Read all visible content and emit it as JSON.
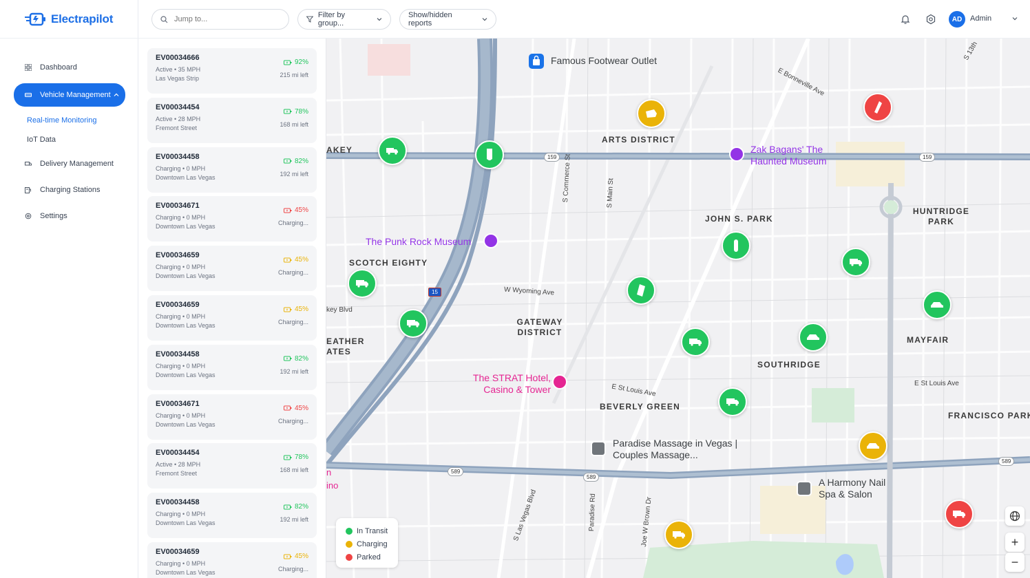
{
  "app": {
    "name": "Electrapilot",
    "brand_color": "#1d6fe6"
  },
  "sidebar": {
    "items": [
      {
        "label": "Dashboard",
        "icon": "grid-icon"
      },
      {
        "label": "Vehicle Management",
        "icon": "car-icon",
        "active": true
      },
      {
        "label": "Delivery Management",
        "icon": "truck-icon"
      },
      {
        "label": "Charging Stations",
        "icon": "charger-icon"
      },
      {
        "label": "Settings",
        "icon": "gear-icon"
      }
    ],
    "sub_items": [
      {
        "label": "Real-time Monitoring",
        "current": true
      },
      {
        "label": "IoT Data"
      }
    ]
  },
  "topbar": {
    "search_placeholder": "Jump to...",
    "filter_label": "Filter by group...",
    "reports_label": "Show/hidden reports",
    "user_initials": "AD",
    "user_name": "Admin"
  },
  "vehicles": [
    {
      "id": "EV00034666",
      "status": "Active • 35 MPH",
      "location": "Las Vegas Strip",
      "battery": "92%",
      "range": "215 mi left",
      "color": "#22c55e"
    },
    {
      "id": "EV00034454",
      "status": "Active • 28 MPH",
      "location": "Fremont Street",
      "battery": "78%",
      "range": "168 mi left",
      "color": "#22c55e"
    },
    {
      "id": "EV00034458",
      "status": "Charging • 0 MPH",
      "location": "Downtown Las Vegas",
      "battery": "82%",
      "range": "192 mi left",
      "color": "#22c55e"
    },
    {
      "id": "EV00034671",
      "status": "Charging • 0 MPH",
      "location": "Downtown Las Vegas",
      "battery": "45%",
      "range": "Charging...",
      "color": "#ef4444"
    },
    {
      "id": "EV00034659",
      "status": "Charging • 0 MPH",
      "location": "Downtown Las Vegas",
      "battery": "45%",
      "range": "Charging...",
      "color": "#eab308"
    },
    {
      "id": "EV00034659",
      "status": "Charging • 0 MPH",
      "location": "Downtown Las Vegas",
      "battery": "45%",
      "range": "Charging...",
      "color": "#eab308"
    },
    {
      "id": "EV00034458",
      "status": "Charging • 0 MPH",
      "location": "Downtown Las Vegas",
      "battery": "82%",
      "range": "192 mi left",
      "color": "#22c55e"
    },
    {
      "id": "EV00034671",
      "status": "Charging • 0 MPH",
      "location": "Downtown Las Vegas",
      "battery": "45%",
      "range": "Charging...",
      "color": "#ef4444"
    },
    {
      "id": "EV00034454",
      "status": "Active • 28 MPH",
      "location": "Fremont Street",
      "battery": "78%",
      "range": "168 mi left",
      "color": "#22c55e"
    },
    {
      "id": "EV00034458",
      "status": "Charging • 0 MPH",
      "location": "Downtown Las Vegas",
      "battery": "82%",
      "range": "192 mi left",
      "color": "#22c55e"
    },
    {
      "id": "EV00034659",
      "status": "Charging • 0 MPH",
      "location": "Downtown Las Vegas",
      "battery": "45%",
      "range": "Charging...",
      "color": "#eab308"
    }
  ],
  "map": {
    "districts": [
      "ARTS DISTRICT",
      "JOHN S. PARK",
      "HUNTRIDGE PARK",
      "SCOTCH EIGHTY",
      "GATEWAY DISTRICT",
      "SOUTHRIDGE",
      "MAYFAIR",
      "BEVERLY GREEN",
      "FRANCISCO PARK",
      "AKEY",
      "EATHER ATES"
    ],
    "pois": [
      "Famous Footwear Outlet",
      "Zak Bagans' The Haunted Museum",
      "The Punk Rock Museum",
      "The STRAT Hotel, Casino & Tower",
      "Paradise Massage in Vegas | Couples Massage...",
      "A Harmony Nail Spa & Salon"
    ],
    "streets": [
      "E Bonneville Ave",
      "S Commerce St",
      "S Main St",
      "W Wyoming Ave",
      "E St Louis Ave",
      "E St Louis Ave",
      "S Las Vegas Blvd",
      "Paradise Rd",
      "Joe W Brown Dr",
      "key Blvd",
      "S 13th",
      "ino",
      "n"
    ],
    "shields": [
      "159",
      "159",
      "15",
      "589",
      "589",
      "589"
    ],
    "legend": [
      {
        "label": "In Transit",
        "color": "#22c55e"
      },
      {
        "label": "Charging",
        "color": "#eab308"
      },
      {
        "label": "Parked",
        "color": "#ef4444"
      }
    ],
    "controls": {
      "globe": "globe-icon",
      "zoom_in": "+",
      "zoom_out": "−"
    }
  }
}
